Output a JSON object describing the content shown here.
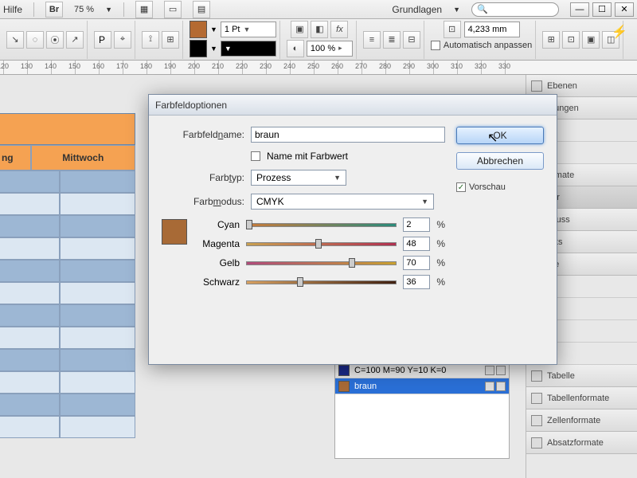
{
  "menubar": {
    "help": "Hilfe",
    "br": "Br",
    "zoom": "75 %",
    "preset": "Grundlagen",
    "search_placeholder": "🔍"
  },
  "toolbar": {
    "stroke_width": "1 Pt",
    "fill_hex": "#b46a32",
    "stroke_black": "#000000",
    "zoom_pct": "100 %",
    "frame_size": "4,233 mm",
    "auto_fit": "Automatisch anpassen"
  },
  "ruler": {
    "start": 120,
    "step": 10,
    "count": 22
  },
  "table": {
    "header": "Mittwoch",
    "extra_header": "ng"
  },
  "dialog": {
    "title": "Farbfeldoptionen",
    "name_label": "Farbfeldname:",
    "name_value": "braun",
    "name_with_value": "Name mit Farbwert",
    "type_label": "Farbtyp:",
    "type_value": "Prozess",
    "mode_label": "Farbmodus:",
    "mode_value": "CMYK",
    "ok": "OK",
    "cancel": "Abbrechen",
    "preview": "Vorschau",
    "preview_hex": "#a86a36",
    "channels": [
      {
        "label": "Cyan",
        "value": "2",
        "gradient": "linear-gradient(90deg,#c77a3a,#2a8a7a)"
      },
      {
        "label": "Magenta",
        "value": "48",
        "gradient": "linear-gradient(90deg,#c8a050,#b03050)"
      },
      {
        "label": "Gelb",
        "value": "70",
        "gradient": "linear-gradient(90deg,#b04a7a,#c8a030)"
      },
      {
        "label": "Schwarz",
        "value": "36",
        "gradient": "linear-gradient(90deg,#d8a060,#402010)"
      }
    ]
  },
  "swatches": [
    {
      "name": "C=100 M=90 Y=10 K=0",
      "hex": "#1a2a8a",
      "sel": false
    },
    {
      "name": "braun",
      "hex": "#a86a36",
      "sel": true
    }
  ],
  "panels": {
    "items": [
      "Ebenen",
      "pfungen",
      "",
      "",
      "ormate",
      "der",
      "nfluss",
      "inks",
      "ute",
      "",
      "",
      "",
      "",
      "Tabelle",
      "Tabellenformate",
      "Zellenformate",
      "Absatzformate"
    ]
  },
  "pct": "%"
}
